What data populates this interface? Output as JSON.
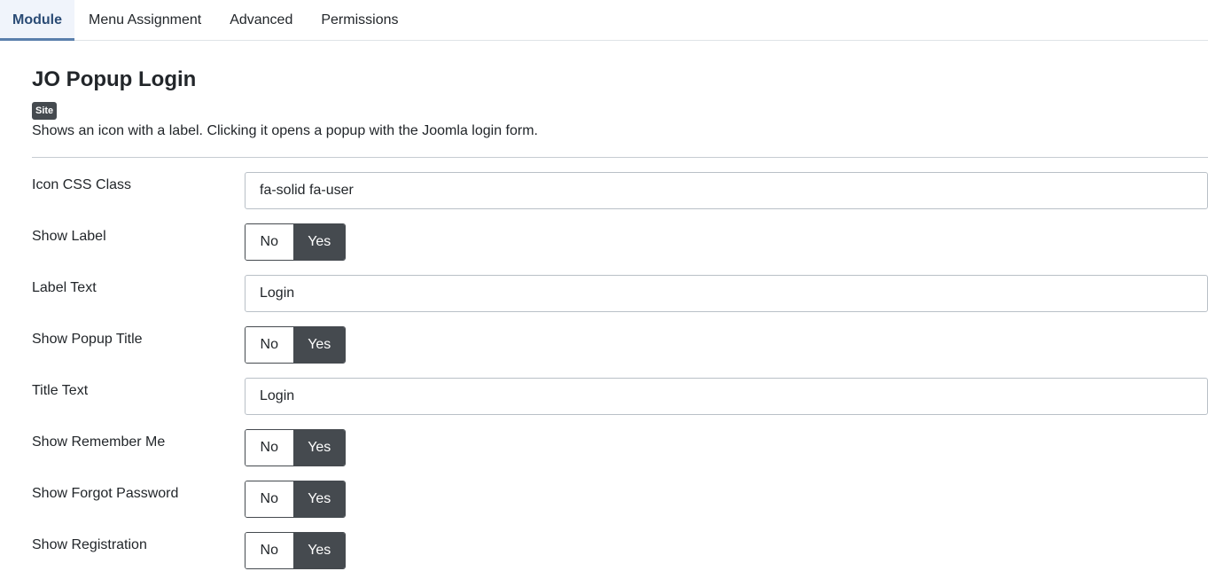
{
  "tabs": [
    {
      "label": "Module",
      "active": true
    },
    {
      "label": "Menu Assignment",
      "active": false
    },
    {
      "label": "Advanced",
      "active": false
    },
    {
      "label": "Permissions",
      "active": false
    }
  ],
  "module": {
    "title": "JO Popup Login",
    "badge": "Site",
    "description": "Shows an icon with a label. Clicking it opens a popup with the Joomla login form."
  },
  "fields": {
    "icon_css_class": {
      "label": "Icon CSS Class",
      "value": "fa-solid fa-user"
    },
    "show_label": {
      "label": "Show Label",
      "no": "No",
      "yes": "Yes",
      "selected": "Yes"
    },
    "label_text": {
      "label": "Label Text",
      "value": "Login"
    },
    "show_popup_title": {
      "label": "Show Popup Title",
      "no": "No",
      "yes": "Yes",
      "selected": "Yes"
    },
    "title_text": {
      "label": "Title Text",
      "value": "Login"
    },
    "show_remember_me": {
      "label": "Show Remember Me",
      "no": "No",
      "yes": "Yes",
      "selected": "Yes"
    },
    "show_forgot_password": {
      "label": "Show Forgot Password",
      "no": "No",
      "yes": "Yes",
      "selected": "Yes"
    },
    "show_registration": {
      "label": "Show Registration",
      "no": "No",
      "yes": "Yes",
      "selected": "Yes"
    }
  },
  "colors": {
    "active_tab_text": "#2a4b75",
    "active_tab_underline": "#5a7fac",
    "switch_selected_bg": "#454a4f",
    "badge_bg": "#454a4f"
  }
}
